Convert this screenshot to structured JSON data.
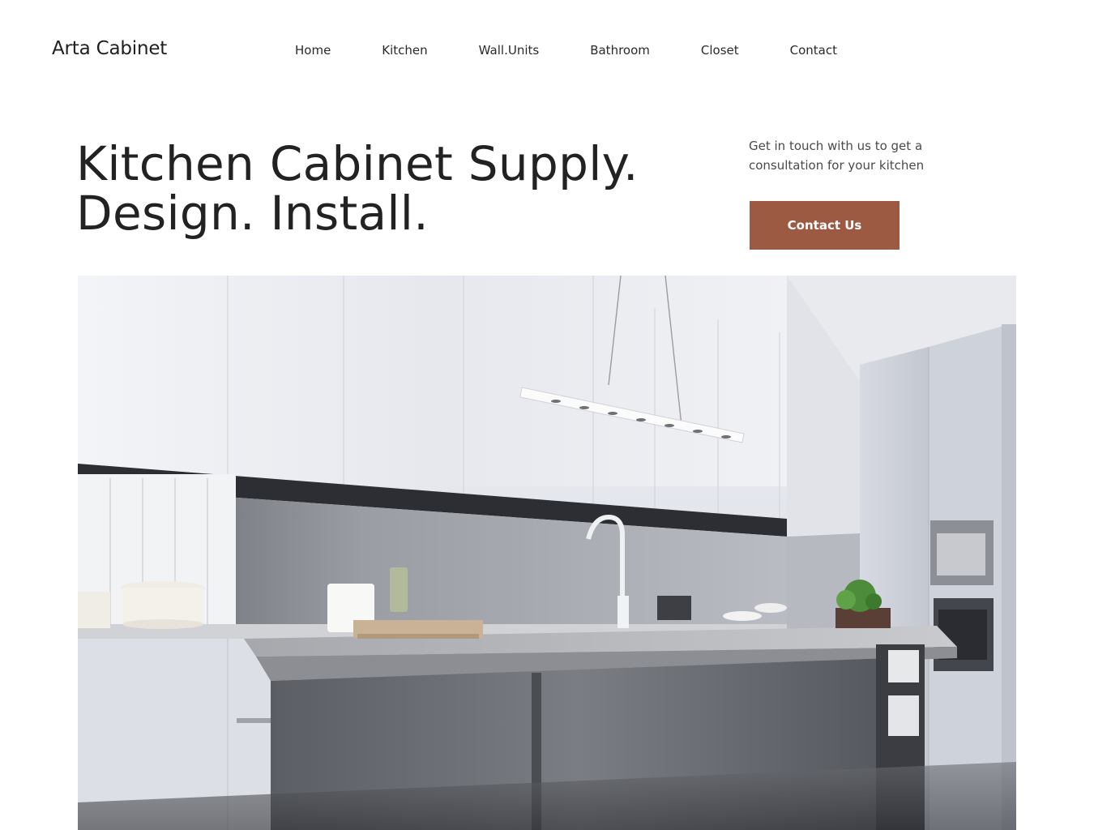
{
  "header": {
    "brand": "Arta Cabinet",
    "nav": [
      {
        "label": "Home"
      },
      {
        "label": "Kitchen"
      },
      {
        "label": "Wall.Units"
      },
      {
        "label": "Bathroom"
      },
      {
        "label": "Closet"
      },
      {
        "label": "Contact"
      }
    ]
  },
  "hero": {
    "title_line1": "Kitchen Cabinet Supply.",
    "title_line2": "Design. Install.",
    "cta_text": "Get in touch with us to get a consultation for your kitchen",
    "cta_button": "Contact Us"
  },
  "colors": {
    "accent": "#9d5a42",
    "text": "#222222",
    "background": "#ffffff"
  }
}
